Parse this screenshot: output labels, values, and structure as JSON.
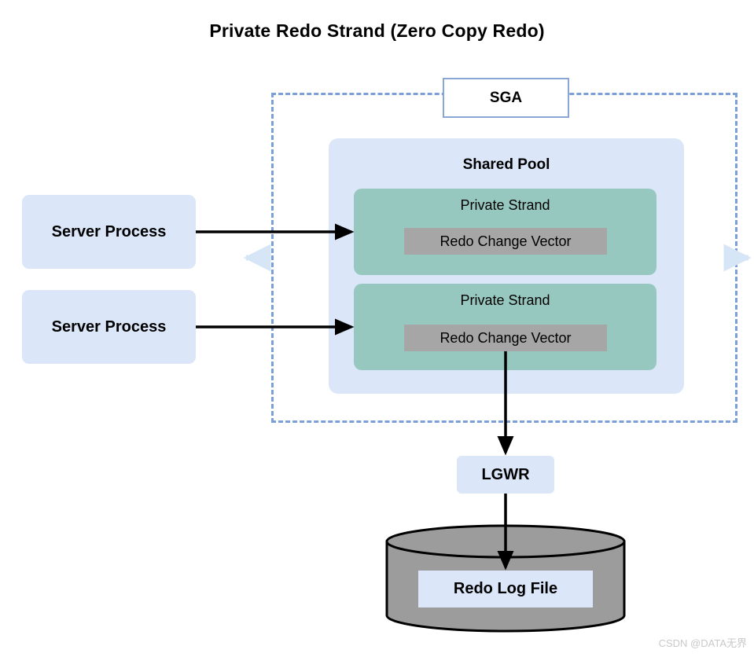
{
  "title": "Private Redo Strand (Zero Copy Redo)",
  "sga": {
    "label": "SGA",
    "border_color": "#7b9fd9",
    "label_border_color": "#8aa6d4"
  },
  "shared_pool": {
    "label": "Shared Pool",
    "fill": "#dbe7f9"
  },
  "private_strands": [
    {
      "label": "Private Strand",
      "fill": "#97c8c0",
      "redo_change_vector": {
        "label": "Redo Change Vector",
        "fill": "#a6a6a6"
      }
    },
    {
      "label": "Private Strand",
      "fill": "#97c8c0",
      "redo_change_vector": {
        "label": "Redo Change Vector",
        "fill": "#a6a6a6"
      }
    }
  ],
  "server_processes": [
    {
      "label": "Server Process",
      "fill": "#dbe7f9"
    },
    {
      "label": "Server Process",
      "fill": "#dbe7f9"
    }
  ],
  "lgwr": {
    "label": "LGWR",
    "fill": "#dbe7f9"
  },
  "redo_log": {
    "label": "Redo Log File",
    "cylinder_fill": "#9c9c9c",
    "cylinder_stroke": "#000000",
    "label_fill": "#dbe7f9"
  },
  "arrows": {
    "flow_color": "#000000",
    "boundary_marker_color": "#d6e6f7",
    "boundary_marker_left": "boundary-arrow-left",
    "boundary_marker_right": "boundary-arrow-right"
  },
  "watermark": "CSDN @DATA无界"
}
